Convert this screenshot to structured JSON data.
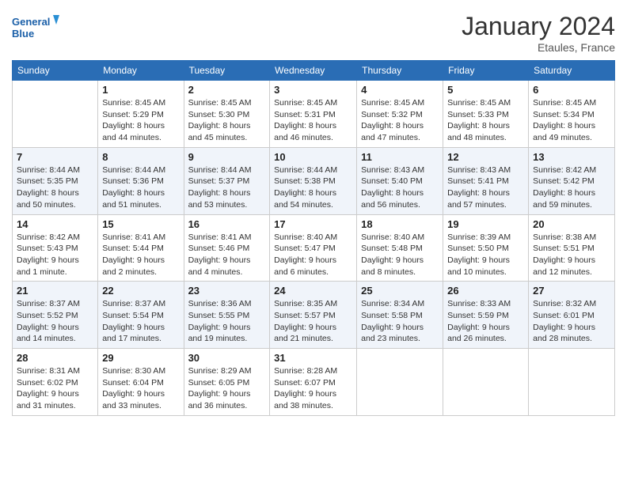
{
  "logo": {
    "line1": "General",
    "line2": "Blue"
  },
  "title": "January 2024",
  "location": "Etaules, France",
  "days_header": [
    "Sunday",
    "Monday",
    "Tuesday",
    "Wednesday",
    "Thursday",
    "Friday",
    "Saturday"
  ],
  "weeks": [
    [
      {
        "num": "",
        "info": ""
      },
      {
        "num": "1",
        "info": "Sunrise: 8:45 AM\nSunset: 5:29 PM\nDaylight: 8 hours\nand 44 minutes."
      },
      {
        "num": "2",
        "info": "Sunrise: 8:45 AM\nSunset: 5:30 PM\nDaylight: 8 hours\nand 45 minutes."
      },
      {
        "num": "3",
        "info": "Sunrise: 8:45 AM\nSunset: 5:31 PM\nDaylight: 8 hours\nand 46 minutes."
      },
      {
        "num": "4",
        "info": "Sunrise: 8:45 AM\nSunset: 5:32 PM\nDaylight: 8 hours\nand 47 minutes."
      },
      {
        "num": "5",
        "info": "Sunrise: 8:45 AM\nSunset: 5:33 PM\nDaylight: 8 hours\nand 48 minutes."
      },
      {
        "num": "6",
        "info": "Sunrise: 8:45 AM\nSunset: 5:34 PM\nDaylight: 8 hours\nand 49 minutes."
      }
    ],
    [
      {
        "num": "7",
        "info": "Sunrise: 8:44 AM\nSunset: 5:35 PM\nDaylight: 8 hours\nand 50 minutes."
      },
      {
        "num": "8",
        "info": "Sunrise: 8:44 AM\nSunset: 5:36 PM\nDaylight: 8 hours\nand 51 minutes."
      },
      {
        "num": "9",
        "info": "Sunrise: 8:44 AM\nSunset: 5:37 PM\nDaylight: 8 hours\nand 53 minutes."
      },
      {
        "num": "10",
        "info": "Sunrise: 8:44 AM\nSunset: 5:38 PM\nDaylight: 8 hours\nand 54 minutes."
      },
      {
        "num": "11",
        "info": "Sunrise: 8:43 AM\nSunset: 5:40 PM\nDaylight: 8 hours\nand 56 minutes."
      },
      {
        "num": "12",
        "info": "Sunrise: 8:43 AM\nSunset: 5:41 PM\nDaylight: 8 hours\nand 57 minutes."
      },
      {
        "num": "13",
        "info": "Sunrise: 8:42 AM\nSunset: 5:42 PM\nDaylight: 8 hours\nand 59 minutes."
      }
    ],
    [
      {
        "num": "14",
        "info": "Sunrise: 8:42 AM\nSunset: 5:43 PM\nDaylight: 9 hours\nand 1 minute."
      },
      {
        "num": "15",
        "info": "Sunrise: 8:41 AM\nSunset: 5:44 PM\nDaylight: 9 hours\nand 2 minutes."
      },
      {
        "num": "16",
        "info": "Sunrise: 8:41 AM\nSunset: 5:46 PM\nDaylight: 9 hours\nand 4 minutes."
      },
      {
        "num": "17",
        "info": "Sunrise: 8:40 AM\nSunset: 5:47 PM\nDaylight: 9 hours\nand 6 minutes."
      },
      {
        "num": "18",
        "info": "Sunrise: 8:40 AM\nSunset: 5:48 PM\nDaylight: 9 hours\nand 8 minutes."
      },
      {
        "num": "19",
        "info": "Sunrise: 8:39 AM\nSunset: 5:50 PM\nDaylight: 9 hours\nand 10 minutes."
      },
      {
        "num": "20",
        "info": "Sunrise: 8:38 AM\nSunset: 5:51 PM\nDaylight: 9 hours\nand 12 minutes."
      }
    ],
    [
      {
        "num": "21",
        "info": "Sunrise: 8:37 AM\nSunset: 5:52 PM\nDaylight: 9 hours\nand 14 minutes."
      },
      {
        "num": "22",
        "info": "Sunrise: 8:37 AM\nSunset: 5:54 PM\nDaylight: 9 hours\nand 17 minutes."
      },
      {
        "num": "23",
        "info": "Sunrise: 8:36 AM\nSunset: 5:55 PM\nDaylight: 9 hours\nand 19 minutes."
      },
      {
        "num": "24",
        "info": "Sunrise: 8:35 AM\nSunset: 5:57 PM\nDaylight: 9 hours\nand 21 minutes."
      },
      {
        "num": "25",
        "info": "Sunrise: 8:34 AM\nSunset: 5:58 PM\nDaylight: 9 hours\nand 23 minutes."
      },
      {
        "num": "26",
        "info": "Sunrise: 8:33 AM\nSunset: 5:59 PM\nDaylight: 9 hours\nand 26 minutes."
      },
      {
        "num": "27",
        "info": "Sunrise: 8:32 AM\nSunset: 6:01 PM\nDaylight: 9 hours\nand 28 minutes."
      }
    ],
    [
      {
        "num": "28",
        "info": "Sunrise: 8:31 AM\nSunset: 6:02 PM\nDaylight: 9 hours\nand 31 minutes."
      },
      {
        "num": "29",
        "info": "Sunrise: 8:30 AM\nSunset: 6:04 PM\nDaylight: 9 hours\nand 33 minutes."
      },
      {
        "num": "30",
        "info": "Sunrise: 8:29 AM\nSunset: 6:05 PM\nDaylight: 9 hours\nand 36 minutes."
      },
      {
        "num": "31",
        "info": "Sunrise: 8:28 AM\nSunset: 6:07 PM\nDaylight: 9 hours\nand 38 minutes."
      },
      {
        "num": "",
        "info": ""
      },
      {
        "num": "",
        "info": ""
      },
      {
        "num": "",
        "info": ""
      }
    ]
  ]
}
